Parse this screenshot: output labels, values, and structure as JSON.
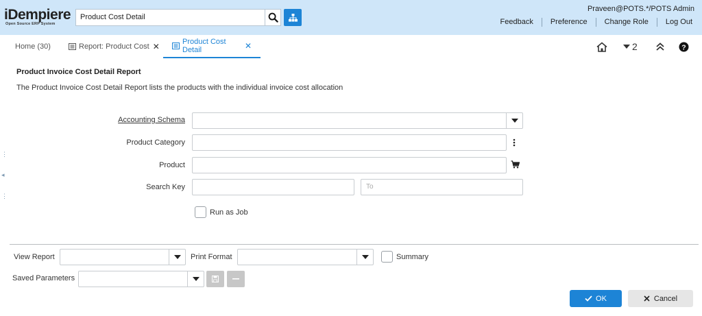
{
  "header": {
    "logo_text": "iDempiere",
    "logo_subtext": "Open Source ERP System",
    "search_value": "Product Cost Detail",
    "user": "Praveen@POTS.*/POTS Admin",
    "links": [
      "Feedback",
      "Preference",
      "Change Role",
      "Log Out"
    ]
  },
  "tabs": [
    {
      "label": "Home (30)"
    },
    {
      "label": "Report: Product Cost"
    },
    {
      "label": "Product Cost Detail"
    }
  ],
  "toolbar": {
    "collapse_count": "2"
  },
  "report": {
    "title": "Product Invoice Cost Detail Report",
    "description": "The Product Invoice Cost Detail Report lists the products with the individual invoice cost allocation"
  },
  "params": {
    "accounting_schema": "Accounting Schema",
    "product_category": "Product Category",
    "product": "Product",
    "search_key": "Search Key",
    "to_placeholder": "To",
    "run_as_job": "Run as Job"
  },
  "footer": {
    "view_report": "View Report",
    "print_format": "Print Format",
    "summary": "Summary",
    "saved_parameters": "Saved Parameters",
    "ok": "OK",
    "cancel": "Cancel"
  },
  "colors": {
    "header_bg": "#cfe6f9",
    "accent": "#1d84d6"
  },
  "icons": [
    "search-icon",
    "sitemap-icon",
    "report-tab-icon",
    "home-icon",
    "collapse-icon",
    "expand-up-icon",
    "help-icon",
    "dropdown-icon",
    "more-vert-icon",
    "cart-icon",
    "save-icon",
    "minus-icon",
    "check-icon",
    "close-icon"
  ]
}
